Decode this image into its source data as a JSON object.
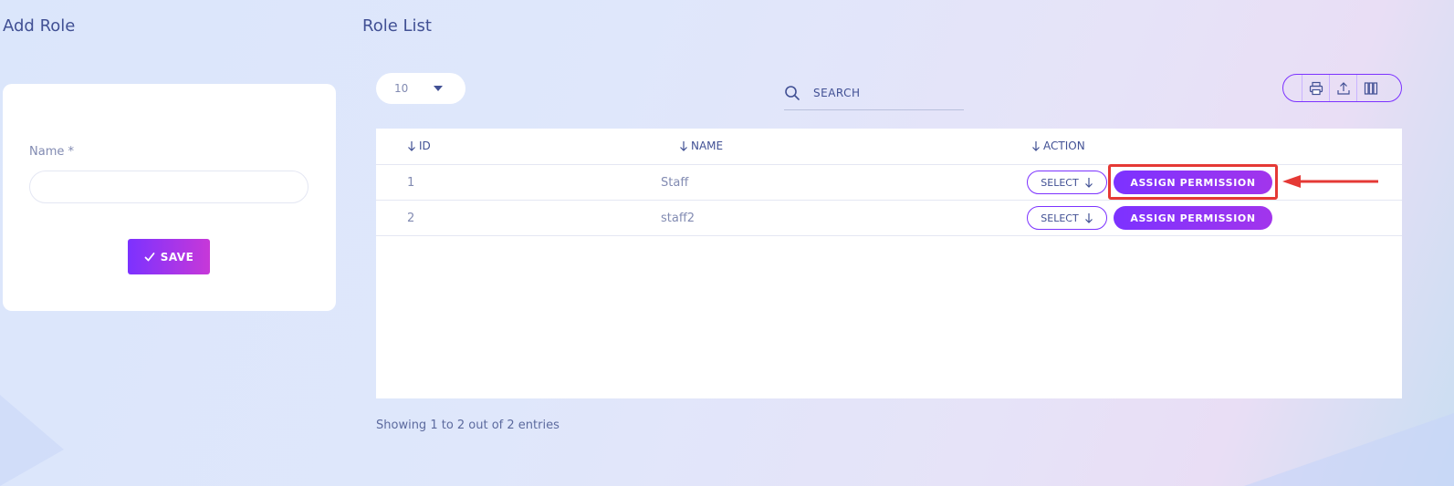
{
  "add_role": {
    "title": "Add Role",
    "name_label": "Name *",
    "name_value": "",
    "save_label": "SAVE",
    "save_icon": "check-icon"
  },
  "role_list": {
    "title": "Role List",
    "page_size": "10",
    "search_placeholder": "SEARCH",
    "toolbar_icons": [
      "print-icon",
      "export-icon",
      "columns-icon"
    ],
    "columns": {
      "id": "ID",
      "name": "NAME",
      "action": "ACTION"
    },
    "rows": [
      {
        "id": "1",
        "name": "Staff",
        "select_label": "SELECT",
        "assign_label": "ASSIGN PERMISSION"
      },
      {
        "id": "2",
        "name": "staff2",
        "select_label": "SELECT",
        "assign_label": "ASSIGN PERMISSION"
      }
    ],
    "footer": "Showing 1 to 2 out of 2 entries"
  },
  "colors": {
    "accent": "#7c32ff",
    "accent_end": "#c738d8",
    "text": "#415094",
    "highlight": "#e53935"
  }
}
